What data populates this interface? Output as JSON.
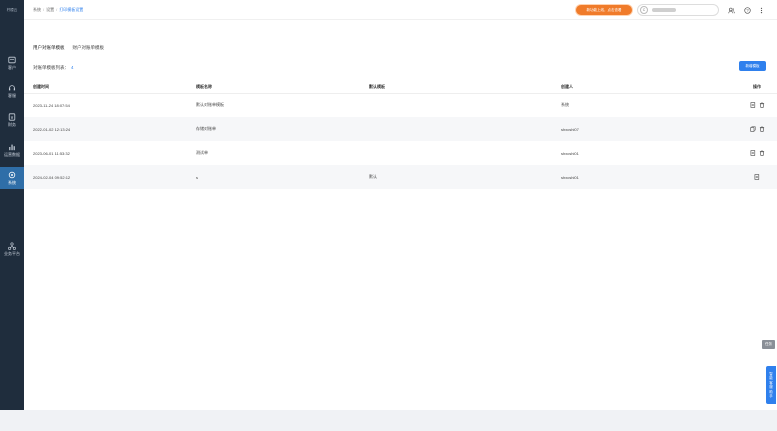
{
  "sidebar": {
    "logo": "柠檬云",
    "items": [
      {
        "label": "客户",
        "icon": "customer-icon"
      },
      {
        "label": "客服",
        "icon": "headset-icon"
      },
      {
        "label": "财务",
        "icon": "finance-icon"
      },
      {
        "label": "运营数据",
        "icon": "chart-icon"
      },
      {
        "label": "系统",
        "icon": "settings-icon",
        "active": true
      },
      {
        "label": "业务平台",
        "icon": "network-icon"
      }
    ]
  },
  "breadcrumb": [
    "系统",
    "设置",
    "打印模板设置"
  ],
  "header": {
    "promo": "新功能上线，点击查看",
    "avatar_initial": "C"
  },
  "tabs": [
    "用户对账单模板",
    "财户对账单模板"
  ],
  "count": {
    "label": "对账单模板列表：",
    "value": "4"
  },
  "add_button": "新增模板",
  "table": {
    "columns": [
      "创建时间",
      "模板名称",
      "默认模板",
      "创建人",
      "操作"
    ],
    "rows": [
      {
        "time": "2023-11-24 18:07:54",
        "name": "默认对账单模板",
        "default": "",
        "creator": "系统",
        "ops": [
          "edit-icon",
          "delete-icon"
        ]
      },
      {
        "time": "2022-01-02 12:13:24",
        "name": "存储对账单",
        "default": "",
        "creator": "shxcshi07",
        "ops": [
          "copy-icon",
          "delete-icon"
        ]
      },
      {
        "time": "2023-06-01 11:53:32",
        "name": "测试单",
        "default": "",
        "creator": "shxcshi01",
        "ops": [
          "edit-icon",
          "delete-icon"
        ]
      },
      {
        "time": "2024-02-04 09:52:12",
        "name": "s",
        "default": "默认",
        "creator": "shxcshi01",
        "ops": [
          "edit-icon"
        ]
      }
    ]
  },
  "float": {
    "tag": "任务",
    "side_tab": [
      "智",
      "能",
      "客",
      "服",
      "助",
      "手"
    ]
  },
  "colors": {
    "sidebar": "#1f2d3d",
    "accent": "#2f80ed",
    "promo": "#f07b2a",
    "active_nav": "#2f6ea8"
  }
}
